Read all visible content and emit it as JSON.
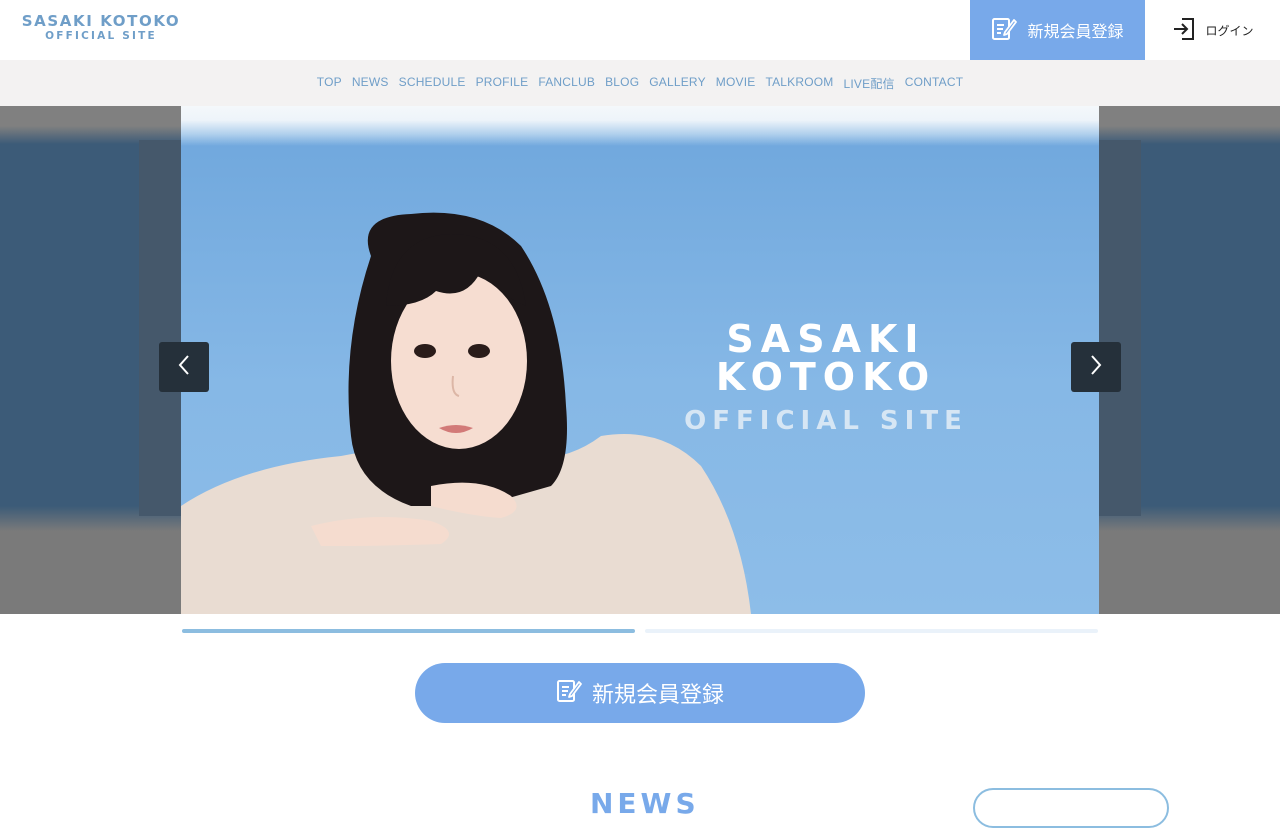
{
  "header": {
    "logo_line1": "SASAKI KOTOKO",
    "logo_line2": "OFFICIAL SITE",
    "signup_label": "新規会員登録",
    "login_label": "ログイン",
    "signup_icon": "edit-note-icon",
    "login_icon": "login-arrow-icon"
  },
  "nav": {
    "items": [
      "TOP",
      "NEWS",
      "SCHEDULE",
      "PROFILE",
      "FANCLUB",
      "BLOG",
      "GALLERY",
      "MOVIE",
      "TALKROOM",
      "LIVE配信",
      "CONTACT"
    ]
  },
  "hero": {
    "title_line1": "SASAKI KOTOKO",
    "title_line2": "OFFICIAL SITE",
    "prev_icon": "chevron-left-icon",
    "next_icon": "chevron-right-icon",
    "slide_count": 2,
    "active_slide": 1
  },
  "cta": {
    "label": "新規会員登録",
    "icon": "edit-note-icon"
  },
  "news": {
    "heading": "NEWS"
  },
  "colors": {
    "accent": "#78a9ea",
    "nav_text": "#6f9ec8",
    "nav_bg": "#f3f2f2",
    "arrow_bg": "#25303a",
    "progress_active": "#8cbde0",
    "progress_inactive": "#eaf2fa"
  }
}
